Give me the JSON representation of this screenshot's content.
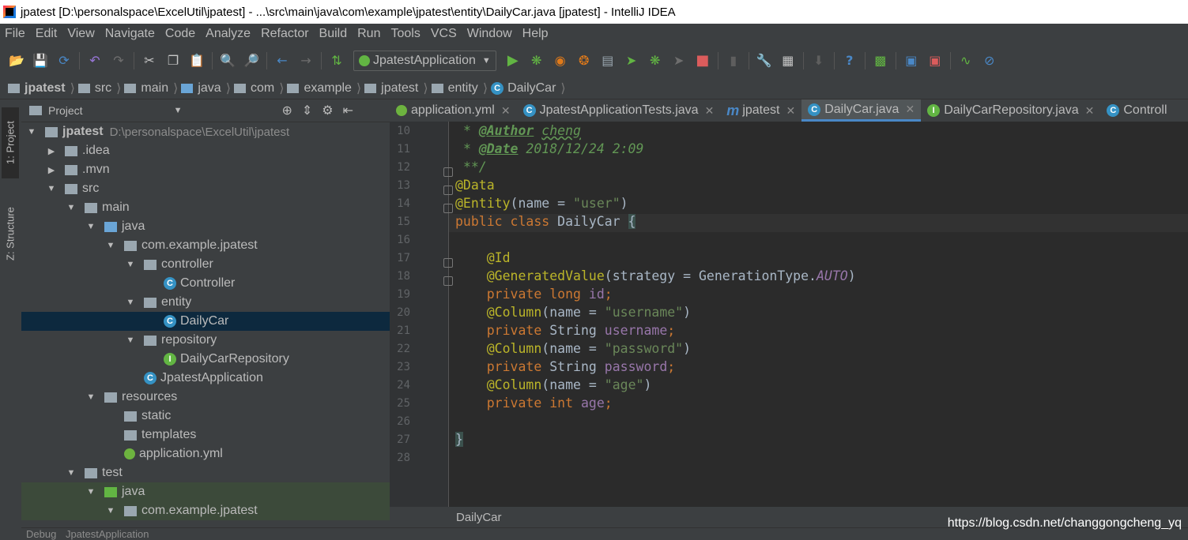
{
  "window": {
    "title": "jpatest [D:\\personalspace\\ExcelUtil\\jpatest] - ...\\src\\main\\java\\com\\example\\jpatest\\entity\\DailyCar.java [jpatest] - IntelliJ IDEA"
  },
  "menu": [
    "File",
    "Edit",
    "View",
    "Navigate",
    "Code",
    "Analyze",
    "Refactor",
    "Build",
    "Run",
    "Tools",
    "VCS",
    "Window",
    "Help"
  ],
  "toolbar": {
    "run_config": "JpatestApplication"
  },
  "breadcrumbs": [
    "jpatest",
    "src",
    "main",
    "java",
    "com",
    "example",
    "jpatest",
    "entity",
    "DailyCar"
  ],
  "side_tabs": {
    "project": "1: Project",
    "structure": "Z: Structure"
  },
  "project_panel": {
    "title": "Project",
    "root_path": "D:\\personalspace\\ExcelUtil\\jpatest",
    "items": [
      {
        "label": "jpatest",
        "depth": 0,
        "expanded": true,
        "icon": "module-folder"
      },
      {
        "label": ".idea",
        "depth": 1,
        "expanded": false,
        "icon": "folder"
      },
      {
        "label": ".mvn",
        "depth": 1,
        "expanded": false,
        "icon": "folder"
      },
      {
        "label": "src",
        "depth": 1,
        "expanded": true,
        "icon": "folder"
      },
      {
        "label": "main",
        "depth": 2,
        "expanded": true,
        "icon": "folder"
      },
      {
        "label": "java",
        "depth": 3,
        "expanded": true,
        "icon": "source-folder"
      },
      {
        "label": "com.example.jpatest",
        "depth": 4,
        "expanded": true,
        "icon": "package"
      },
      {
        "label": "controller",
        "depth": 5,
        "expanded": true,
        "icon": "package"
      },
      {
        "label": "Controller",
        "depth": 6,
        "icon": "class"
      },
      {
        "label": "entity",
        "depth": 5,
        "expanded": true,
        "icon": "package"
      },
      {
        "label": "DailyCar",
        "depth": 6,
        "icon": "class",
        "selected": true
      },
      {
        "label": "repository",
        "depth": 5,
        "expanded": true,
        "icon": "package"
      },
      {
        "label": "DailyCarRepository",
        "depth": 6,
        "icon": "interface"
      },
      {
        "label": "JpatestApplication",
        "depth": 5,
        "icon": "spring-class"
      },
      {
        "label": "resources",
        "depth": 3,
        "expanded": true,
        "icon": "resources-folder"
      },
      {
        "label": "static",
        "depth": 4,
        "icon": "folder"
      },
      {
        "label": "templates",
        "depth": 4,
        "icon": "folder"
      },
      {
        "label": "application.yml",
        "depth": 4,
        "icon": "yml"
      },
      {
        "label": "test",
        "depth": 2,
        "expanded": true,
        "icon": "folder"
      },
      {
        "label": "java",
        "depth": 3,
        "expanded": true,
        "icon": "test-folder"
      },
      {
        "label": "com.example.jpatest",
        "depth": 4,
        "expanded": true,
        "icon": "package"
      }
    ]
  },
  "tabs": [
    {
      "label": "application.yml",
      "icon": "yml"
    },
    {
      "label": "JpatestApplicationTests.java",
      "icon": "class"
    },
    {
      "label": "jpatest",
      "icon": "maven"
    },
    {
      "label": "DailyCar.java",
      "icon": "class",
      "active": true
    },
    {
      "label": "DailyCarRepository.java",
      "icon": "interface"
    },
    {
      "label": "Controll",
      "icon": "class"
    }
  ],
  "editor": {
    "line_numbers": [
      "10",
      "11",
      "12",
      "13",
      "14",
      "15",
      "16",
      "17",
      "18",
      "19",
      "20",
      "21",
      "22",
      "23",
      "24",
      "25",
      "26",
      "27",
      "28"
    ],
    "current_line": "15",
    "breadcrumb": "DailyCar"
  },
  "bottom": {
    "debug_label": "Debug",
    "debug_config": "JpatestApplication"
  },
  "watermark": "https://blog.csdn.net/changgongcheng_yq"
}
